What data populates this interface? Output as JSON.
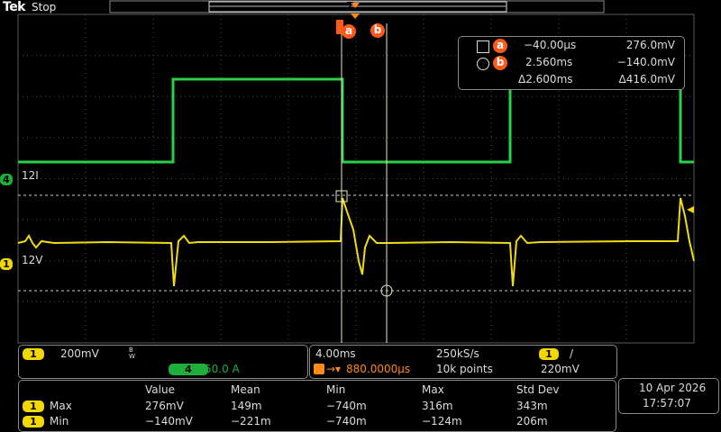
{
  "header": {
    "brand": "Tek",
    "run_state": "Stop",
    "trigger_marker": "T"
  },
  "cursor_tags": {
    "a": "a",
    "b": "b"
  },
  "colors": {
    "ch1": "#f0d800",
    "ch4": "#1fae3a",
    "cursor": "#ff5a1c",
    "grid": "#4a4a4a"
  },
  "channels": {
    "ch4": {
      "number": "4",
      "label": "12I"
    },
    "ch1": {
      "number": "1",
      "label": "12V"
    }
  },
  "cursor_readout": {
    "a": {
      "time": "−40.00µs",
      "value": "276.0mV"
    },
    "b": {
      "time": "2.560ms",
      "value": "−140.0mV"
    },
    "delta": {
      "time": "Δ2.600ms",
      "value": "Δ416.0mV"
    }
  },
  "vertical": {
    "ch1_number": "1",
    "ch1_scale": "200mV",
    "bw_mark": "B W",
    "ch4_number": "4",
    "ch4_scale": "50.0 A"
  },
  "horizontal": {
    "time_div": "4.00ms",
    "sample_rate": "250kS/s",
    "trigger_delay": "880.0000µs",
    "record_length": "10k points",
    "trig_source": "1",
    "trig_slope": "/",
    "trig_level": "220mV"
  },
  "measurements": {
    "headers": [
      "Value",
      "Mean",
      "Min",
      "Max",
      "Std Dev"
    ],
    "rows": [
      {
        "ch": "1",
        "name": "Max",
        "values": [
          "276mV",
          "149m",
          "−740m",
          "316m",
          "343m"
        ]
      },
      {
        "ch": "1",
        "name": "Min",
        "values": [
          "−140mV",
          "−221m",
          "−740m",
          "−124m",
          "206m"
        ]
      }
    ]
  },
  "datetime": {
    "date": "10 Apr  2026",
    "time": "17:57:07"
  }
}
